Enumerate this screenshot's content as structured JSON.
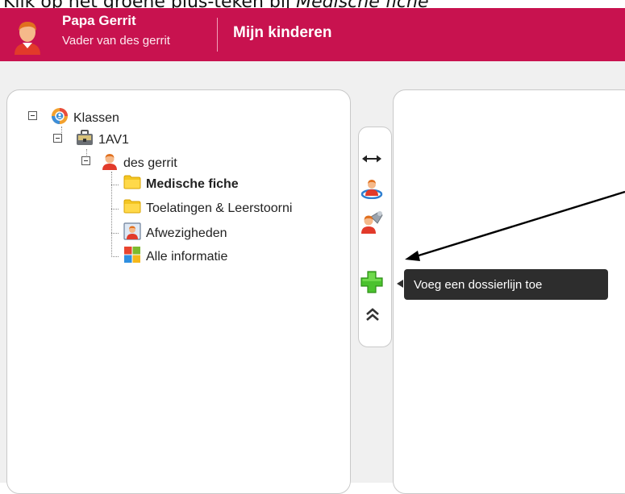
{
  "instruction": {
    "text_before": "Klik op het groene plus-teken bij ",
    "text_emphasis": "Medische fiche"
  },
  "header": {
    "user_name": "Papa Gerrit",
    "user_role": "Vader van des gerrit",
    "nav_link": "Mijn kinderen",
    "accent_color": "#c8124f"
  },
  "tree": {
    "root": {
      "label": "Klassen",
      "icon": "classes-globe-icon"
    },
    "class": {
      "label": "1AV1",
      "icon": "briefcase-icon"
    },
    "student": {
      "label": "des gerrit",
      "icon": "student-avatar-icon"
    },
    "items": [
      {
        "label": "Medische fiche",
        "icon": "folder-icon",
        "selected": true
      },
      {
        "label": "Toelatingen & Leerstoorni",
        "icon": "folder-icon",
        "selected": false
      },
      {
        "label": "Afwezigheden",
        "icon": "absence-portrait-icon",
        "selected": false
      },
      {
        "label": "Alle informatie",
        "icon": "tiles-icon",
        "selected": false
      }
    ]
  },
  "toolbar": {
    "buttons": [
      {
        "name": "expand-width-icon"
      },
      {
        "name": "user-target-icon"
      },
      {
        "name": "user-settings-icon"
      },
      {
        "name": "green-plus-icon"
      },
      {
        "name": "collapse-up-icon"
      }
    ]
  },
  "tooltip": {
    "text": "Voeg een dossierlijn toe"
  }
}
